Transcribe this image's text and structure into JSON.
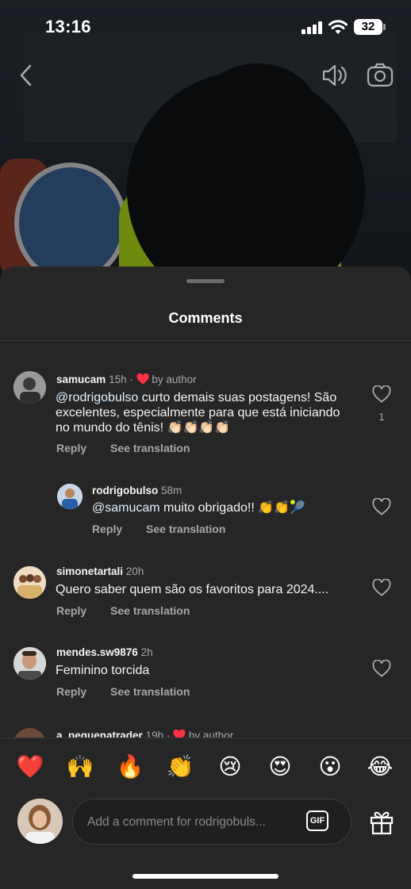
{
  "status_bar": {
    "time": "13:16",
    "battery": "32"
  },
  "sheet": {
    "title": "Comments"
  },
  "comments": [
    {
      "username": "samucam",
      "time": "15h",
      "separator": "·",
      "by_author": "by author",
      "mention": "@rodrigobulso",
      "text": " curto demais suas postagens! São excelentes, especialmente para que está iniciando no mundo do tênis! 👏🏻👏🏻👏🏻👏🏻",
      "reply_label": "Reply",
      "translate_label": "See translation",
      "like_count": "1"
    },
    {
      "username": "rodrigobulso",
      "time": "58m",
      "mention": "@samucam",
      "text": " muito obrigado!! 👏👏🎾",
      "reply_label": "Reply",
      "translate_label": "See translation"
    },
    {
      "username": "simonetartali",
      "time": "20h",
      "text": "Quero saber quem são os favoritos para 2024....",
      "reply_label": "Reply",
      "translate_label": "See translation"
    },
    {
      "username": "mendes.sw9876",
      "time": "2h",
      "text": "Feminino torcida",
      "reply_label": "Reply",
      "translate_label": "See translation"
    },
    {
      "username": "a_pequenatrader",
      "time": "19h",
      "separator": "·",
      "by_author": "by author"
    }
  ],
  "emoji_bar": [
    "❤️",
    "🙌",
    "🔥",
    "👏",
    "😢",
    "😍",
    "😮",
    "😂"
  ],
  "composer": {
    "placeholder": "Add a comment for rodrigobuls...",
    "gif_label": "GIF"
  },
  "colors": {
    "sheet_bg": "#262626",
    "heart_red": "#ff3040",
    "accent_green": "#a9d61a"
  },
  "icons": [
    "back-chevron-icon",
    "speaker-icon",
    "camera-icon",
    "heart-outline-icon",
    "gift-icon"
  ]
}
